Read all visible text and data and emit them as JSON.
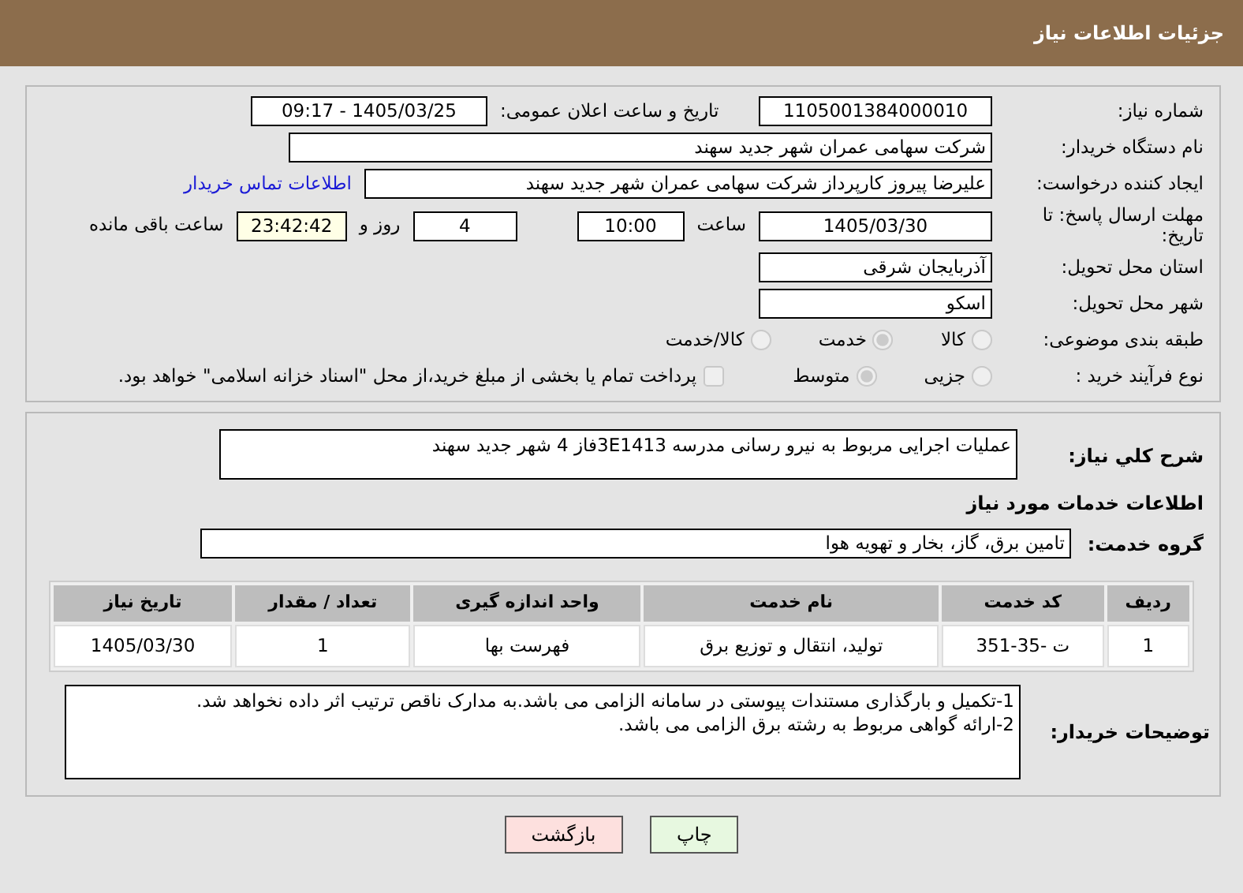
{
  "header": {
    "title": "جزئیات اطلاعات نیاز"
  },
  "need_info": {
    "need_number": {
      "label": "شماره نیاز:",
      "value": "1105001384000010"
    },
    "announce_datetime": {
      "label": "تاریخ و ساعت اعلان عمومی:",
      "value": "1405/03/25 - 09:17"
    },
    "buyer_org": {
      "label": "نام دستگاه خریدار:",
      "value": "شرکت سهامی عمران شهر جدید سهند"
    },
    "requester": {
      "label": "ایجاد کننده درخواست:",
      "value": "علیرضا پیروز کارپرداز شرکت سهامی عمران شهر جدید سهند",
      "link": "اطلاعات تماس خریدار"
    },
    "deadline": {
      "label": "مهلت ارسال پاسخ: تا تاریخ:",
      "date": "1405/03/30",
      "time_label": "ساعت",
      "time": "10:00",
      "days": "4",
      "days_label": "روز و",
      "remaining": "23:42:42",
      "remaining_label": "ساعت باقی مانده"
    },
    "province": {
      "label": "استان محل تحویل:",
      "value": "آذربایجان شرقی"
    },
    "city": {
      "label": "شهر محل تحویل:",
      "value": "اسکو"
    },
    "category": {
      "label": "طبقه بندی موضوعی:",
      "options": [
        {
          "label": "کالا",
          "selected": false,
          "disabled": true
        },
        {
          "label": "خدمت",
          "selected": true,
          "disabled": true
        },
        {
          "label": "کالا/خدمت",
          "selected": false,
          "disabled": true
        }
      ]
    },
    "process_type": {
      "label": "نوع فرآیند خرید :",
      "options": [
        {
          "label": "جزیی",
          "selected": false,
          "disabled": true
        },
        {
          "label": "متوسط",
          "selected": true,
          "disabled": true
        }
      ],
      "treasury_payment": {
        "checked": false,
        "disabled": true,
        "label": "پرداخت تمام یا بخشی از مبلغ خرید،از محل \"اسناد خزانه اسلامی\" خواهد بود."
      }
    }
  },
  "details": {
    "description": {
      "label": "شرح کلي نياز:",
      "value": "عملیات اجرایی مربوط به نیرو رسانی مدرسه 3E1413فاز 4 شهر جدید سهند"
    },
    "section_title": "اطلاعات خدمات مورد نیاز",
    "service_group": {
      "label": "گروه خدمت:",
      "value": "تامین برق، گاز، بخار و تهویه هوا"
    },
    "table": {
      "columns": [
        "ردیف",
        "کد خدمت",
        "نام خدمت",
        "واحد اندازه گیری",
        "تعداد / مقدار",
        "تاریخ نیاز"
      ],
      "rows": [
        [
          "1",
          "ت -35-351",
          "تولید، انتقال و توزیع برق",
          "فهرست بها",
          "1",
          "1405/03/30"
        ]
      ]
    },
    "buyer_notes": {
      "label": "توضیحات خریدار:",
      "lines": [
        "1-تکمیل و بارگذاری مستندات پیوستی در سامانه الزامی می باشد.به مدارک ناقص ترتیب اثر داده نخواهد شد.",
        "2-ارائه گواهی مربوط به رشته برق الزامی می باشد."
      ]
    }
  },
  "buttons": [
    {
      "label": "چاپ",
      "kind": "print"
    },
    {
      "label": "بازگشت",
      "kind": "back"
    }
  ]
}
